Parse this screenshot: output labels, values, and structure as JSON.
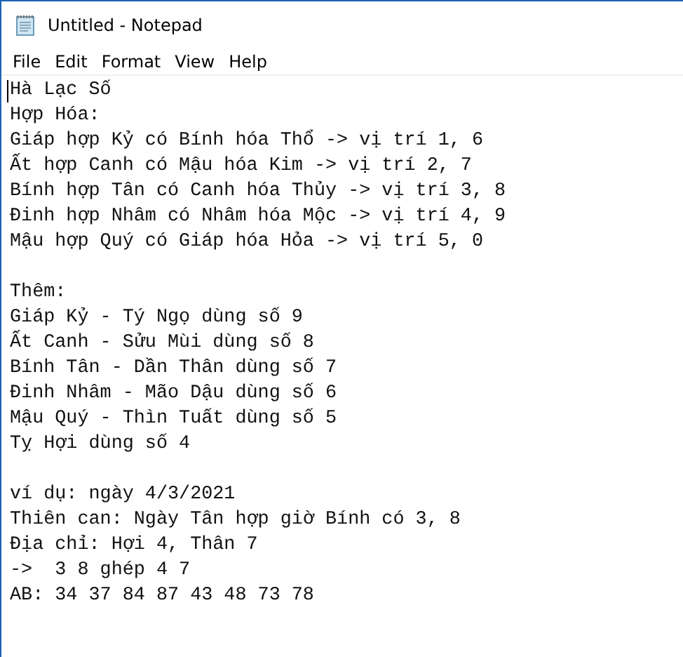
{
  "window": {
    "title": "Untitled - Notepad"
  },
  "menu": [
    "File",
    "Edit",
    "Format",
    "View",
    "Help"
  ],
  "editor": {
    "paragraphs": [
      [
        "Hà Lạc Số",
        "Hợp Hóa:",
        "Giáp hợp Kỷ có Bính hóa Thổ -> vị trí 1, 6",
        "Ất hợp Canh có Mậu hóa Kim -> vị trí 2, 7",
        "Bính hợp Tân có Canh hóa Thủy -> vị trí 3, 8",
        "Đinh hợp Nhâm có Nhâm hóa Mộc -> vị trí 4, 9",
        "Mậu hợp Quý có Giáp hóa Hỏa -> vị trí 5, 0"
      ],
      [
        "Thêm:",
        "Giáp Kỷ - Tý Ngọ dùng số 9",
        "Ất Canh - Sửu Mùi dùng số 8",
        "Bính Tân - Dần Thân dùng số 7",
        "Đinh Nhâm - Mão Dậu dùng số 6",
        "Mậu Quý - Thìn Tuất dùng số 5",
        "Tỵ Hợi dùng số 4"
      ],
      [
        "ví dụ: ngày 4/3/2021",
        "Thiên can: Ngày Tân hợp giờ Bính có 3, 8",
        "Địa chỉ: Hợi 4, Thân 7",
        "->  3 8 ghép 4 7",
        "AB: 34 37 84 87 43 48 73 78"
      ]
    ]
  }
}
